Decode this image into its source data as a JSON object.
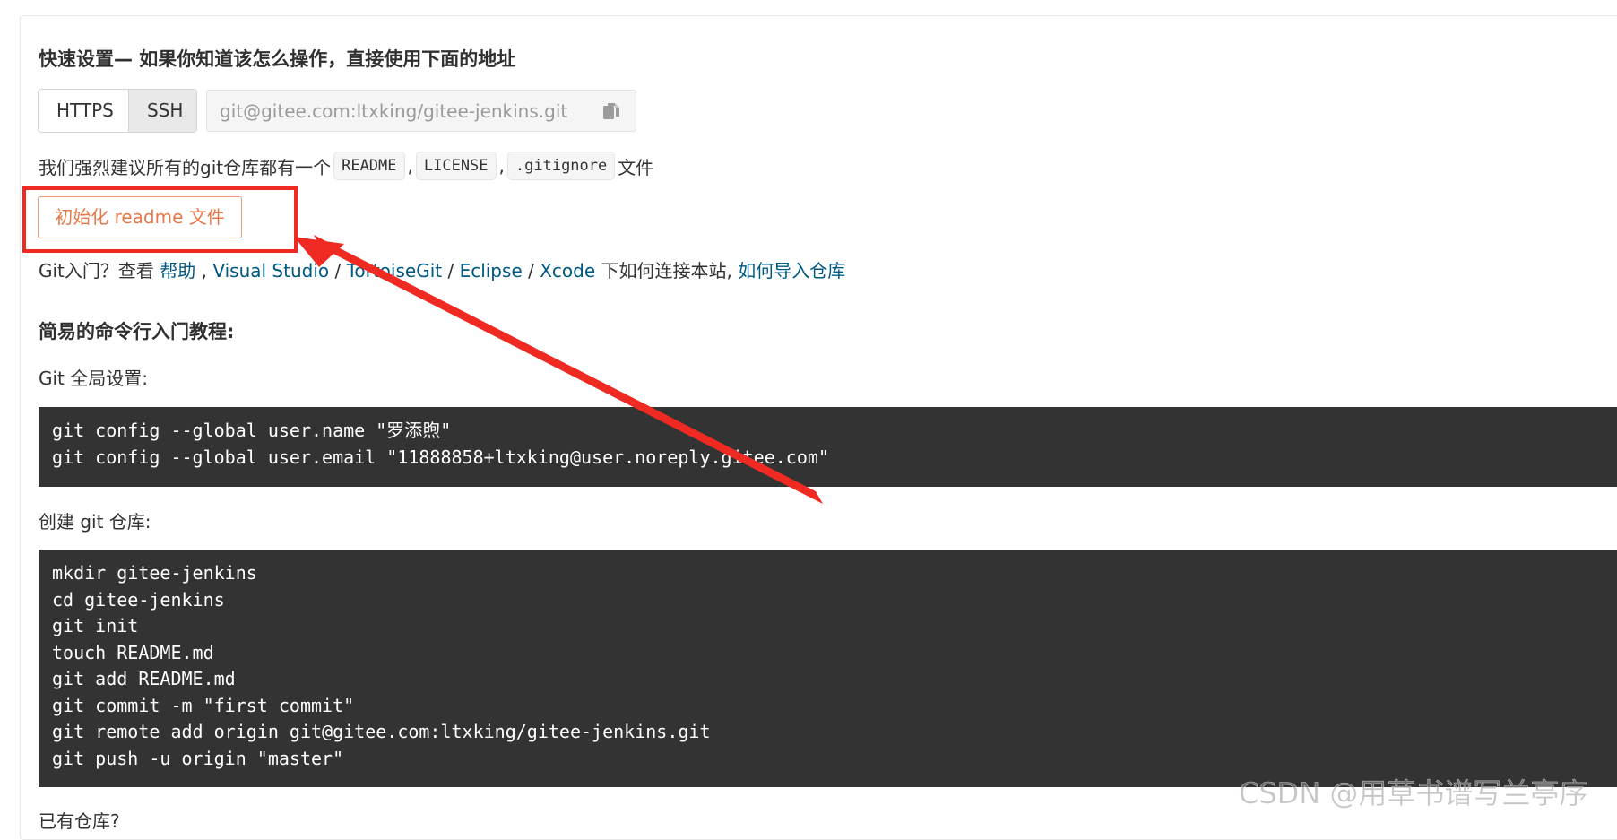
{
  "quick_setup": {
    "title": "快速设置— 如果你知道该怎么操作，直接使用下面的地址",
    "protocols": [
      "HTTPS",
      "SSH"
    ],
    "selected_protocol": "SSH",
    "repo_url": "git@gitee.com:ltxking/gitee-jenkins.git",
    "copy_icon": "copy-icon"
  },
  "recommend": {
    "prefix": "我们强烈建议所有的git仓库都有一个",
    "files": [
      "README",
      "LICENSE",
      ".gitignore"
    ],
    "separator": ",",
    "suffix": "文件"
  },
  "init_button": {
    "label": "初始化 readme 文件"
  },
  "help": {
    "prefix": "Git入门？查看 ",
    "help_link": "帮助",
    "sep_comma": " , ",
    "links": [
      "Visual Studio",
      "TortoiseGit",
      "Eclipse",
      "Xcode"
    ],
    "slash": " / ",
    "middle": " 下如何连接本站, ",
    "import_link": "如何导入仓库"
  },
  "tutorial": {
    "title": "简易的命令行入门教程:",
    "global_label": "Git 全局设置:",
    "global_code": [
      "git config --global user.name \"罗添煦\"",
      "git config --global user.email \"11888858+ltxking@user.noreply.gitee.com\""
    ],
    "create_label": "创建 git 仓库:",
    "create_code": [
      "mkdir gitee-jenkins",
      "cd gitee-jenkins",
      "git init",
      "touch README.md",
      "git add README.md",
      "git commit -m \"first commit\"",
      "git remote add origin git@gitee.com:ltxking/gitee-jenkins.git",
      "git push -u origin \"master\""
    ],
    "existing_label": "已有仓库?"
  },
  "annotation": {
    "color": "#ee2a22"
  },
  "watermark": "CSDN @用草书谱写兰亭序"
}
